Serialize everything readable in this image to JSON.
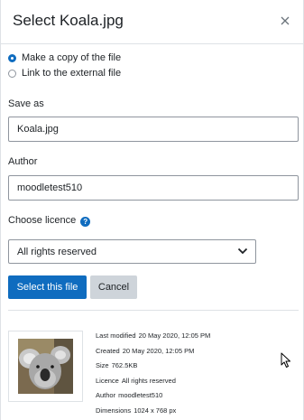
{
  "dialog": {
    "title": "Select Koala.jpg"
  },
  "options": {
    "copy_label": "Make a copy of the file",
    "link_label": "Link to the external file",
    "selected": "copy"
  },
  "save_as": {
    "label": "Save as",
    "value": "Koala.jpg"
  },
  "author": {
    "label": "Author",
    "value": "moodletest510"
  },
  "licence": {
    "label": "Choose licence",
    "selected": "All rights reserved"
  },
  "buttons": {
    "select_label": "Select this file",
    "cancel_label": "Cancel"
  },
  "file_info": {
    "last_modified_label": "Last modified",
    "last_modified": "20 May 2020, 12:05 PM",
    "created_label": "Created",
    "created": "20 May 2020, 12:05 PM",
    "size_label": "Size",
    "size": "762.5KB",
    "licence_label": "Licence",
    "licence": "All rights reserved",
    "author_label": "Author",
    "author": "moodletest510",
    "dimensions_label": "Dimensions",
    "dimensions": "1024 x 768 px"
  },
  "icons": {
    "close": "close-icon",
    "help": "question-circle-icon",
    "dropdown": "chevron-down-icon",
    "cursor": "mouse-pointer-icon"
  },
  "colors": {
    "primary": "#0f6cbf",
    "secondary": "#ced4da",
    "border": "#8f959e"
  }
}
